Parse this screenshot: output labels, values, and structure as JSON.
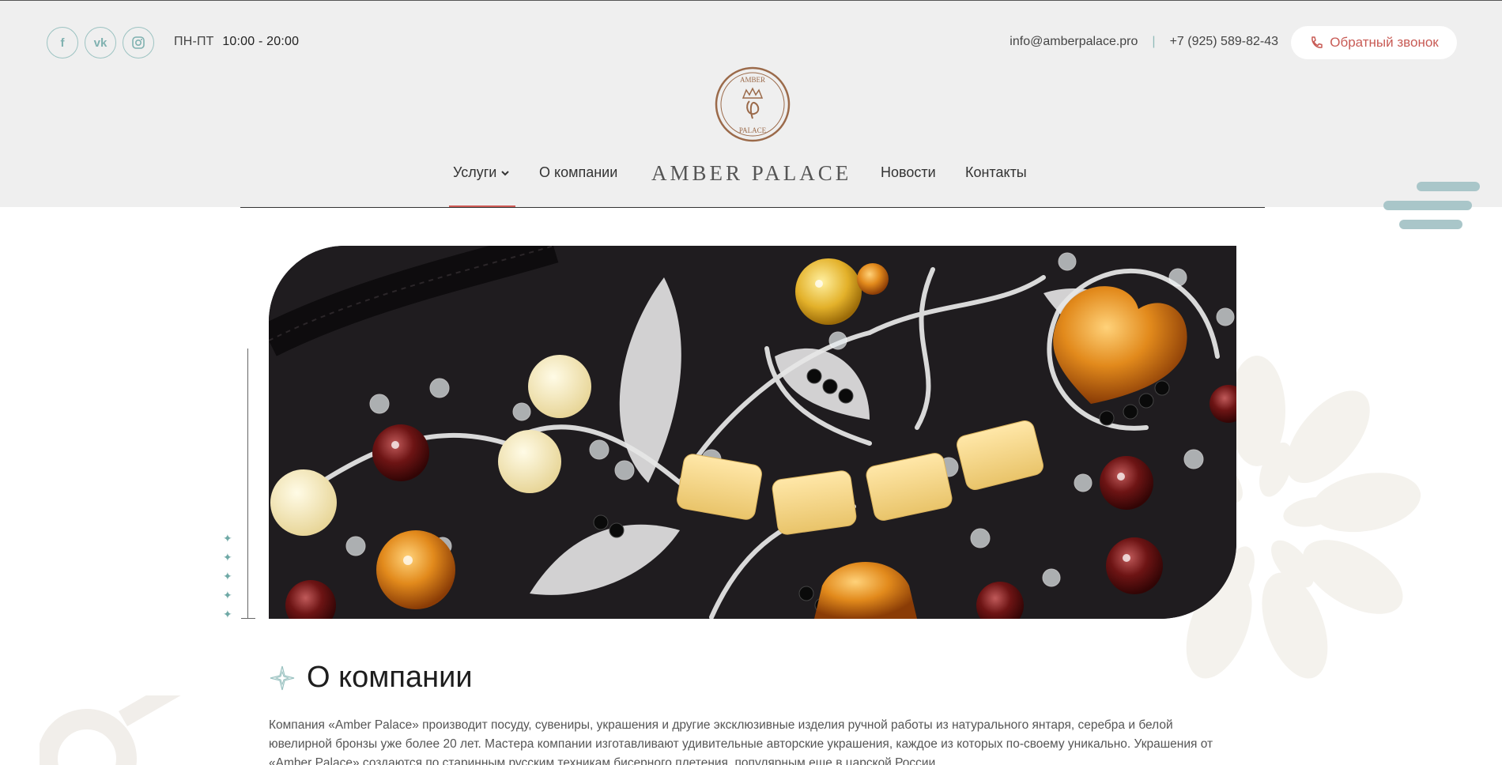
{
  "header": {
    "socials": [
      {
        "icon": "facebook-icon",
        "glyph": "f"
      },
      {
        "icon": "vk-icon",
        "glyph": "vk"
      },
      {
        "icon": "instagram-icon",
        "glyph": "◎"
      }
    ],
    "hours_days": "ПН-ПТ",
    "hours_time": "10:00 - 20:00",
    "email": "info@amberpalace.pro",
    "separator": "|",
    "phone": "+7 (925) 589-82-43",
    "callback_label": "Обратный звонок"
  },
  "logo": {
    "top_text": "AMBER",
    "bottom_text": "PALACE"
  },
  "nav": {
    "services": "Услуги",
    "about": "О компании",
    "brand": "AMBER PALACE",
    "news": "Новости",
    "contacts": "Контакты"
  },
  "about": {
    "title": "О компании",
    "text": "Компания «Amber Palace» производит посуду, сувениры, украшения и другие эксклюзивные изделия ручной работы из натурального янтаря, серебра и белой ювелирной бронзы уже более 20 лет. Мастера компании изготавливают удивительные авторские украшения, каждое из которых по-своему уникально. Украшения от «Amber Palace» создаются по старинным русским техникам бисерного плетения, популярным еще в царской России."
  },
  "colors": {
    "accent": "#d05b57",
    "teal": "#7fb1b0",
    "header_bg": "#efefef",
    "logo_brown": "#9b6a4a"
  }
}
